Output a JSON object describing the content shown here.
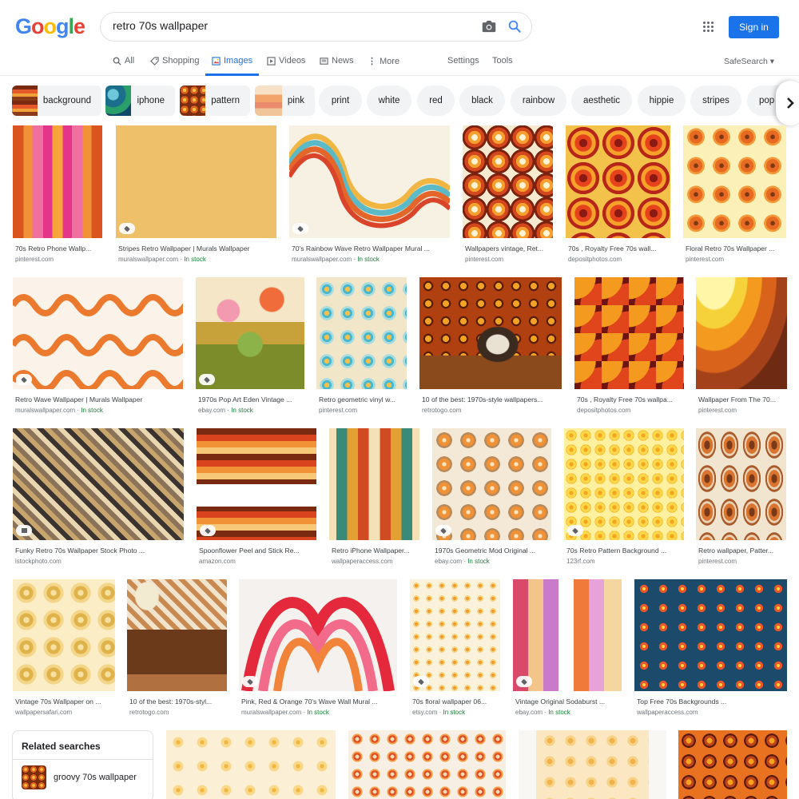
{
  "logo": {
    "letters": [
      "G",
      "o",
      "o",
      "g",
      "l",
      "e"
    ],
    "colors": [
      "#4285f4",
      "#ea4335",
      "#fbbc05",
      "#4285f4",
      "#34a853",
      "#ea4335"
    ]
  },
  "search": {
    "query": "retro 70s wallpaper"
  },
  "header": {
    "signin_label": "Sign in"
  },
  "tabs": [
    {
      "label": "All",
      "icon": "search-icon"
    },
    {
      "label": "Shopping",
      "icon": "tag-icon"
    },
    {
      "label": "Images",
      "icon": "image-icon",
      "active": true
    },
    {
      "label": "Videos",
      "icon": "play-icon"
    },
    {
      "label": "News",
      "icon": "news-icon"
    },
    {
      "label": "More",
      "icon": "more-vert-icon"
    },
    {
      "label": "Settings"
    },
    {
      "label": "Tools"
    }
  ],
  "safesearch": "SafeSearch ▾",
  "chips": [
    "background",
    "iphone",
    "pattern",
    "pink",
    "print",
    "white",
    "red",
    "black",
    "rainbow",
    "aesthetic",
    "hippie",
    "stripes",
    "pop"
  ],
  "results": [
    {
      "title": "70s Retro Phone Wallp...",
      "source": "pinterest.com",
      "stock": ""
    },
    {
      "title": "Stripes Retro Wallpaper | Murals Wallpaper",
      "source": "muralswallpaper.com",
      "stock": "In stock"
    },
    {
      "title": "70's Rainbow Wave Retro Wallpaper Mural ...",
      "source": "muralswallpaper.com",
      "stock": "In stock"
    },
    {
      "title": "Wallpapers vintage, Ret...",
      "source": "pinterest.com",
      "stock": ""
    },
    {
      "title": "70s , Royalty Free 70s wall...",
      "source": "depositphotos.com",
      "stock": ""
    },
    {
      "title": "Floral Retro 70s Wallpaper ...",
      "source": "pinterest.com",
      "stock": ""
    },
    {
      "title": "Retro Wave Wallpaper | Murals Wallpaper",
      "source": "muralswallpaper.com",
      "stock": "In stock"
    },
    {
      "title": "1970s Pop Art Eden Vintage ...",
      "source": "ebay.com",
      "stock": "In stock"
    },
    {
      "title": "Retro geometric vinyl w...",
      "source": "pinterest.com",
      "stock": ""
    },
    {
      "title": "10 of the best: 1970s-style wallpapers...",
      "source": "retrotogo.com",
      "stock": ""
    },
    {
      "title": "70s , Royalty Free 70s wallpa...",
      "source": "depositphotos.com",
      "stock": ""
    },
    {
      "title": "Wallpaper From The 70...",
      "source": "pinterest.com",
      "stock": ""
    },
    {
      "title": "Funky Retro 70s Wallpaper Stock Photo ...",
      "source": "istockphoto.com",
      "stock": ""
    },
    {
      "title": "Spoonflower Peel and Stick Re...",
      "source": "amazon.com",
      "stock": ""
    },
    {
      "title": "Retro iPhone Wallpaper...",
      "source": "wallpaperaccess.com",
      "stock": ""
    },
    {
      "title": "1970s Geometric Mod Original ...",
      "source": "ebay.com",
      "stock": "In stock"
    },
    {
      "title": "70s Retro Pattern Background ...",
      "source": "123rf.com",
      "stock": ""
    },
    {
      "title": "Retro wallpaper, Patter...",
      "source": "pinterest.com",
      "stock": ""
    },
    {
      "title": "Vintage 70s Wallpaper on ...",
      "source": "wallpapersafari.com",
      "stock": ""
    },
    {
      "title": "10 of the best: 1970s-styl...",
      "source": "retrotogo.com",
      "stock": ""
    },
    {
      "title": "Pink, Red & Orange 70's Wave Wall Mural ...",
      "source": "muralswallpaper.com",
      "stock": "In stock"
    },
    {
      "title": "70s floral wallpaper 06...",
      "source": "etsy.com",
      "stock": "In stock"
    },
    {
      "title": "Vintage Original Sodaburst ...",
      "source": "ebay.com",
      "stock": "In stock"
    },
    {
      "title": "Top Free 70s Backgrounds ...",
      "source": "wallpaperaccess.com",
      "stock": ""
    }
  ],
  "related": {
    "heading": "Related searches",
    "item": "groovy 70s wallpaper"
  }
}
